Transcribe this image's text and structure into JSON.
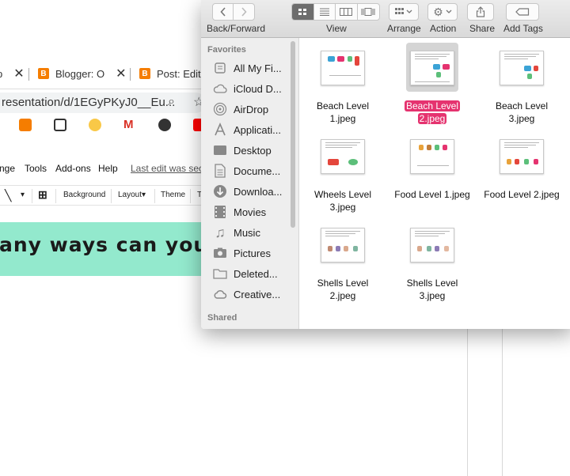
{
  "browser": {
    "tabs": [
      {
        "label": "p",
        "close": "✕"
      },
      {
        "label": "Blogger: O",
        "close": "✕"
      },
      {
        "label": "Post: Edit",
        "close": ""
      }
    ],
    "url": "resentation/d/1EGyPKyJ0__Eu...",
    "slides_menu": [
      "nge",
      "Tools",
      "Add-ons",
      "Help",
      "Last edit was sec"
    ],
    "slides_toolbar": [
      "Background",
      "Layout▾",
      "Theme",
      "T"
    ],
    "slide_text": "any ways can you sc"
  },
  "finder": {
    "toolbar": {
      "back_forward": "Back/Forward",
      "view": "View",
      "arrange": "Arrange",
      "action": "Action",
      "share": "Share",
      "add_tags": "Add Tags"
    },
    "sidebar": {
      "favorites_label": "Favorites",
      "shared_label": "Shared",
      "items": [
        {
          "label": "All My Fi...",
          "icon": "all-files-icon"
        },
        {
          "label": "iCloud D...",
          "icon": "icloud-icon"
        },
        {
          "label": "AirDrop",
          "icon": "airdrop-icon"
        },
        {
          "label": "Applicati...",
          "icon": "applications-icon"
        },
        {
          "label": "Desktop",
          "icon": "desktop-icon"
        },
        {
          "label": "Docume...",
          "icon": "documents-icon"
        },
        {
          "label": "Downloa...",
          "icon": "downloads-icon"
        },
        {
          "label": "Movies",
          "icon": "movies-icon"
        },
        {
          "label": "Music",
          "icon": "music-icon"
        },
        {
          "label": "Pictures",
          "icon": "pictures-icon"
        },
        {
          "label": "Deleted...",
          "icon": "folder-icon"
        },
        {
          "label": "Creative...",
          "icon": "creative-cloud-icon"
        }
      ]
    },
    "files": [
      {
        "line1": "Beach Level",
        "line2": "1.jpeg",
        "selected": false
      },
      {
        "line1": "Beach Level",
        "line2": "2.jpeg",
        "selected": true
      },
      {
        "line1": "Beach Level",
        "line2": "3.jpeg",
        "selected": false
      },
      {
        "line1": "Wheels Level",
        "line2": "3.jpeg",
        "selected": false
      },
      {
        "line1": "Food Level 1.jpeg",
        "line2": "",
        "selected": false
      },
      {
        "line1": "Food Level 2.jpeg",
        "line2": "",
        "selected": false
      },
      {
        "line1": "Shells Level",
        "line2": "2.jpeg",
        "selected": false
      },
      {
        "line1": "Shells Level",
        "line2": "3.jpeg",
        "selected": false
      }
    ],
    "colors": {
      "selection": "#e5336f",
      "slide_banner": "#93e9cd",
      "blogger": "#f57d00"
    }
  }
}
